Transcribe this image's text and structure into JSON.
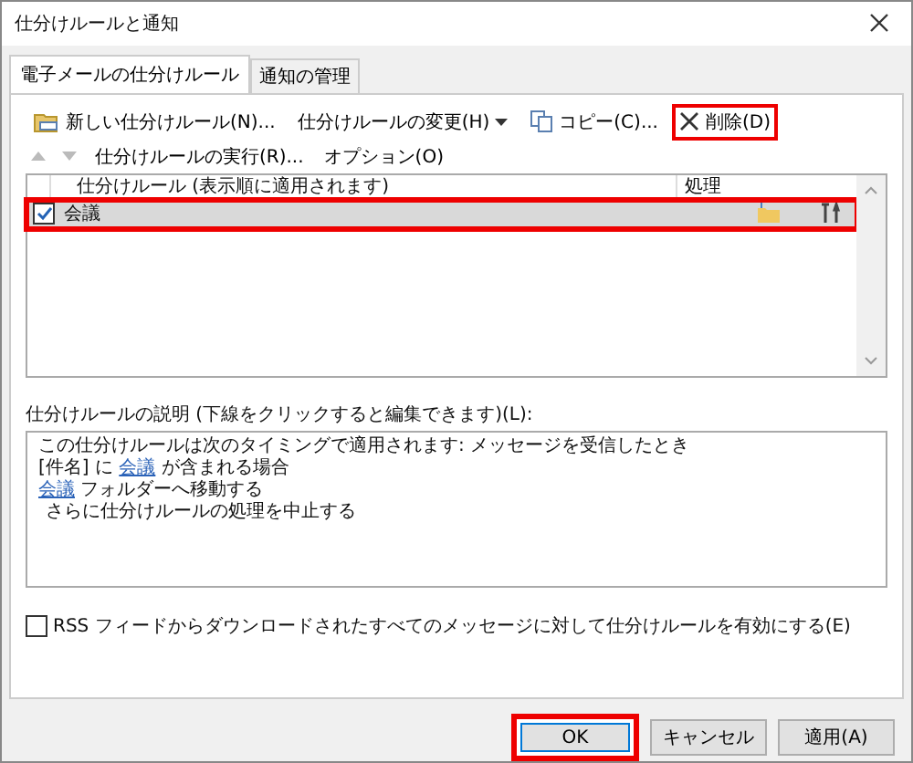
{
  "window": {
    "title": "仕分けルールと通知"
  },
  "tabs": [
    {
      "label": "電子メールの仕分けルール",
      "selected": true
    },
    {
      "label": "通知の管理",
      "selected": false
    }
  ],
  "toolbar": [
    {
      "kind": "new",
      "label": "新しい仕分けルール(N)...",
      "highlighted": false
    },
    {
      "kind": "change",
      "label": "仕分けルールの変更(H)",
      "highlighted": false
    },
    {
      "kind": "copy",
      "label": "コピー(C)...",
      "highlighted": false
    },
    {
      "kind": "delete",
      "label": "削除(D)",
      "highlighted": true
    }
  ],
  "move_buttons": [
    {
      "kind": "up",
      "disabled": true
    },
    {
      "kind": "down",
      "disabled": true
    }
  ],
  "actions": [
    "仕分けルールの実行(R)...",
    "オプション(O)"
  ],
  "rules_table": {
    "columns": [
      "仕分けルール (表示順に適用されます)",
      "処理"
    ],
    "rows": [
      {
        "name": "会議",
        "checked": true,
        "selected": true,
        "highlighted": true
      }
    ]
  },
  "description": {
    "label": "仕分けルールの説明 (下線をクリックすると編集できます)(L):",
    "lines": [
      {
        "indented": false,
        "parts": [
          {
            "text": "この仕分けルールは次のタイミングで適用されます: メッセージを受信したとき",
            "link": false
          }
        ]
      },
      {
        "indented": false,
        "parts": [
          {
            "text": "[件名] に ",
            "link": false
          },
          {
            "text": "会議",
            "link": true
          },
          {
            "text": " が含まれる場合",
            "link": false
          }
        ]
      },
      {
        "indented": false,
        "parts": [
          {
            "text": "会議",
            "link": true
          },
          {
            "text": " フォルダーへ移動する",
            "link": false
          }
        ]
      },
      {
        "indented": true,
        "parts": [
          {
            "text": "さらに仕分けルールの処理を中止する",
            "link": false
          }
        ]
      }
    ]
  },
  "rss": {
    "label": "RSS フィードからダウンロードされたすべてのメッセージに対して仕分けルールを有効にする(E)",
    "checked": false
  },
  "buttons": [
    {
      "label": "OK",
      "default": true,
      "highlighted": true
    },
    {
      "label": "キャンセル",
      "default": false,
      "highlighted": false
    },
    {
      "label": "適用(A)",
      "default": false,
      "highlighted": false
    }
  ]
}
